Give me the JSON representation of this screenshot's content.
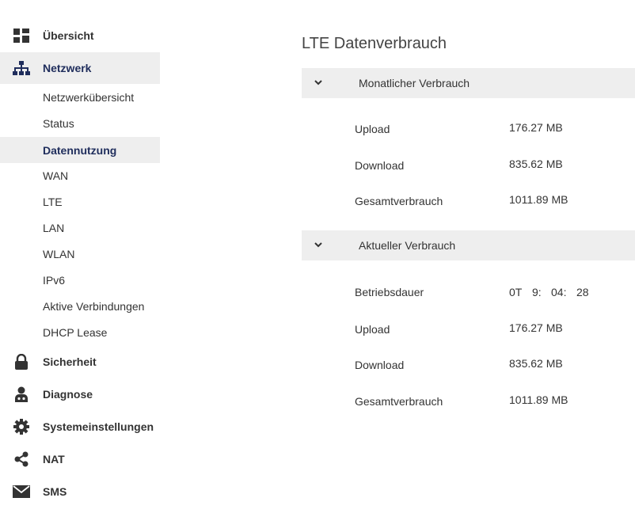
{
  "sidebar": {
    "overview": "Übersicht",
    "network": "Netzwerk",
    "network_sub": [
      "Netzwerkübersicht",
      "Status",
      "Datennutzung",
      "WAN",
      "LTE",
      "LAN",
      "WLAN",
      "IPv6",
      "Aktive Verbindungen",
      "DHCP Lease"
    ],
    "security": "Sicherheit",
    "diagnostics": "Diagnose",
    "system_settings": "Systemeinstellungen",
    "nat": "NAT",
    "sms": "SMS",
    "active_sub": "Datennutzung"
  },
  "main": {
    "title": "LTE Datenverbrauch",
    "monthly": {
      "header": "Monatlicher Verbrauch",
      "upload_label": "Upload",
      "upload_value": "176.27 MB",
      "download_label": "Download",
      "download_value": "835.62 MB",
      "total_label": "Gesamtverbrauch",
      "total_value": "1011.89 MB"
    },
    "current": {
      "header": "Aktueller Verbrauch",
      "uptime_label": "Betriebsdauer",
      "uptime_days": "0T",
      "uptime_hours": "9:",
      "uptime_minutes": "04:",
      "uptime_seconds": "28",
      "upload_label": "Upload",
      "upload_value": "176.27 MB",
      "download_label": "Download",
      "download_value": "835.62 MB",
      "total_label": "Gesamtverbrauch",
      "total_value": "1011.89 MB"
    }
  },
  "colors": {
    "accent": "#1f2d5c",
    "active_bg": "#eeeeee",
    "icon": "#333333"
  },
  "icons": {
    "overview": "dashboard-icon",
    "network": "sitemap-icon",
    "security": "lock-icon",
    "diagnostics": "doctor-icon",
    "system_settings": "gear-icon",
    "nat": "share-icon",
    "sms": "envelope-icon"
  }
}
